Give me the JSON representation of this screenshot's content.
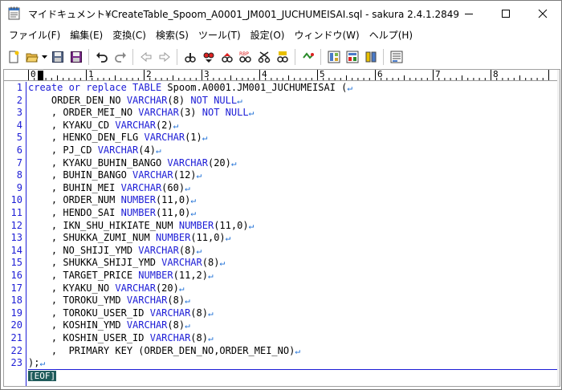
{
  "window": {
    "title": "マイドキュメント¥CreateTable_Spoom_A0001_JM001_JUCHUMEISAI.sql - sakura 2.4.1.2849"
  },
  "menu": {
    "items": [
      "ファイル(F)",
      "編集(E)",
      "変換(C)",
      "検索(S)",
      "ツール(T)",
      "設定(O)",
      "ウィンドウ(W)",
      "ヘルプ(H)"
    ]
  },
  "toolbar": {
    "buttons": [
      "new-file-icon",
      "open-folder-icon",
      "save-icon",
      "save-all-icon",
      "undo-icon",
      "redo-icon",
      "back-icon",
      "forward-icon",
      "find-icon",
      "find-next-icon",
      "find-prev-icon",
      "replace-icon",
      "cut-icon",
      "grep-icon",
      "tag-jump-icon",
      "outline-icon",
      "function-list-icon",
      "compare-icon",
      "settings-icon"
    ]
  },
  "ruler": {
    "labels": [
      "0",
      "1",
      "2",
      "3",
      "4",
      "5",
      "6",
      "7",
      "8"
    ]
  },
  "editor": {
    "lines": [
      [
        {
          "t": "create or replace TABLE ",
          "k": true
        },
        {
          "t": "Spoom.A0001.JM001_JUCHUMEISAI (",
          "k": false
        }
      ],
      [
        {
          "t": "    ORDER_DEN_NO ",
          "k": false
        },
        {
          "t": "VARCHAR",
          "k": true
        },
        {
          "t": "(8) ",
          "k": false
        },
        {
          "t": "NOT NULL",
          "k": true
        }
      ],
      [
        {
          "t": "    , ORDER_MEI_NO ",
          "k": false
        },
        {
          "t": "VARCHAR",
          "k": true
        },
        {
          "t": "(3) ",
          "k": false
        },
        {
          "t": "NOT NULL",
          "k": true
        }
      ],
      [
        {
          "t": "    , KYAKU_CD ",
          "k": false
        },
        {
          "t": "VARCHAR",
          "k": true
        },
        {
          "t": "(2)",
          "k": false
        }
      ],
      [
        {
          "t": "    , HENKO_DEN_FLG ",
          "k": false
        },
        {
          "t": "VARCHAR",
          "k": true
        },
        {
          "t": "(1)",
          "k": false
        }
      ],
      [
        {
          "t": "    , PJ_CD ",
          "k": false
        },
        {
          "t": "VARCHAR",
          "k": true
        },
        {
          "t": "(4)",
          "k": false
        }
      ],
      [
        {
          "t": "    , KYAKU_BUHIN_BANGO ",
          "k": false
        },
        {
          "t": "VARCHAR",
          "k": true
        },
        {
          "t": "(20)",
          "k": false
        }
      ],
      [
        {
          "t": "    , BUHIN_BANGO ",
          "k": false
        },
        {
          "t": "VARCHAR",
          "k": true
        },
        {
          "t": "(12)",
          "k": false
        }
      ],
      [
        {
          "t": "    , BUHIN_MEI ",
          "k": false
        },
        {
          "t": "VARCHAR",
          "k": true
        },
        {
          "t": "(60)",
          "k": false
        }
      ],
      [
        {
          "t": "    , ORDER_NUM ",
          "k": false
        },
        {
          "t": "NUMBER",
          "k": true
        },
        {
          "t": "(11,0)",
          "k": false
        }
      ],
      [
        {
          "t": "    , HENDO_SAI ",
          "k": false
        },
        {
          "t": "NUMBER",
          "k": true
        },
        {
          "t": "(11,0)",
          "k": false
        }
      ],
      [
        {
          "t": "    , IKN_SHU_HIKIATE_NUM ",
          "k": false
        },
        {
          "t": "NUMBER",
          "k": true
        },
        {
          "t": "(11,0)",
          "k": false
        }
      ],
      [
        {
          "t": "    , SHUKKA_ZUMI_NUM ",
          "k": false
        },
        {
          "t": "NUMBER",
          "k": true
        },
        {
          "t": "(11,0)",
          "k": false
        }
      ],
      [
        {
          "t": "    , NO_SHIJI_YMD ",
          "k": false
        },
        {
          "t": "VARCHAR",
          "k": true
        },
        {
          "t": "(8)",
          "k": false
        }
      ],
      [
        {
          "t": "    , SHUKKA_SHIJI_YMD ",
          "k": false
        },
        {
          "t": "VARCHAR",
          "k": true
        },
        {
          "t": "(8)",
          "k": false
        }
      ],
      [
        {
          "t": "    , TARGET_PRICE ",
          "k": false
        },
        {
          "t": "NUMBER",
          "k": true
        },
        {
          "t": "(11,2)",
          "k": false
        }
      ],
      [
        {
          "t": "    , KYAKU_NO ",
          "k": false
        },
        {
          "t": "VARCHAR",
          "k": true
        },
        {
          "t": "(20)",
          "k": false
        }
      ],
      [
        {
          "t": "    , TOROKU_YMD ",
          "k": false
        },
        {
          "t": "VARCHAR",
          "k": true
        },
        {
          "t": "(8)",
          "k": false
        }
      ],
      [
        {
          "t": "    , TOROKU_USER_ID ",
          "k": false
        },
        {
          "t": "VARCHAR",
          "k": true
        },
        {
          "t": "(8)",
          "k": false
        }
      ],
      [
        {
          "t": "    , KOSHIN_YMD ",
          "k": false
        },
        {
          "t": "VARCHAR",
          "k": true
        },
        {
          "t": "(8)",
          "k": false
        }
      ],
      [
        {
          "t": "    , KOSHIN_USER_ID ",
          "k": false
        },
        {
          "t": "VARCHAR",
          "k": true
        },
        {
          "t": "(8)",
          "k": false
        }
      ],
      [
        {
          "t": "    ,  PRIMARY KEY (ORDER_DEN_NO,ORDER_MEI_NO)",
          "k": false
        }
      ],
      [
        {
          "t": ");",
          "k": false
        }
      ]
    ],
    "eol_mark": "↵",
    "eof_label": "[EOF]"
  },
  "colors": {
    "keyword": "#1d1dd6",
    "line_number": "#1d1dd6",
    "eof_bg": "#1f5b5b"
  }
}
